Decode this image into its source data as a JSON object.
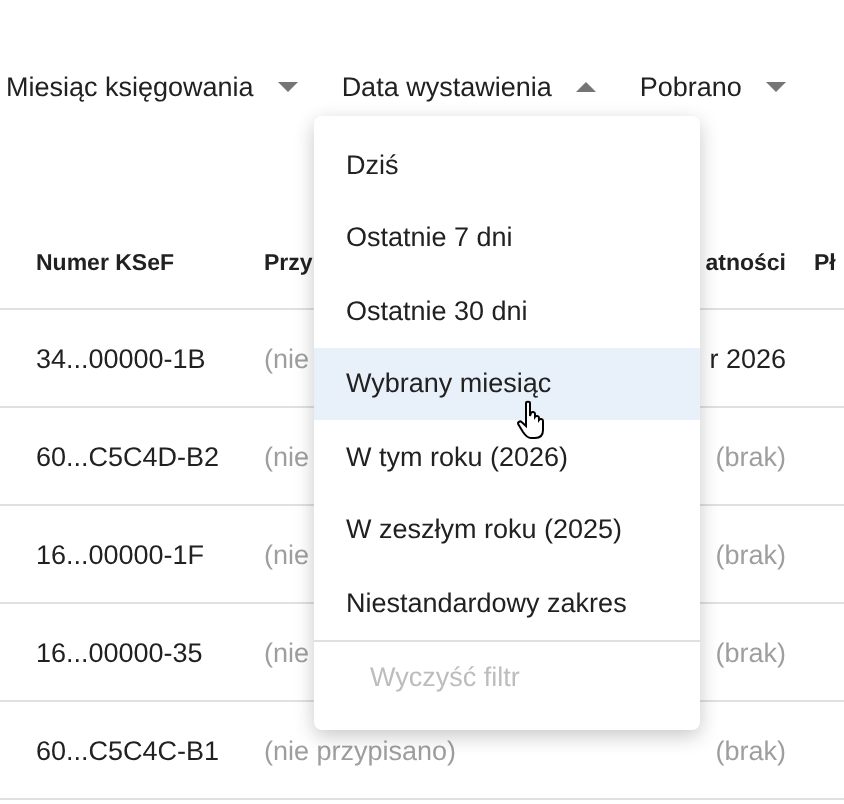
{
  "filters": [
    {
      "label": "Miesiąc księgowania",
      "expanded": false
    },
    {
      "label": "Data wystawienia",
      "expanded": true
    },
    {
      "label": "Pobrano",
      "expanded": false
    }
  ],
  "table": {
    "columns": [
      "Numer KSeF",
      "Przy",
      "atności",
      "Pł"
    ],
    "rows": [
      {
        "cells": [
          {
            "text": "34...00000-1B",
            "muted": false
          },
          {
            "text": "(nie",
            "muted": true
          },
          {
            "text": "r 2026",
            "muted": false
          }
        ]
      },
      {
        "cells": [
          {
            "text": "60...C5C4D-B2",
            "muted": false
          },
          {
            "text": "(nie",
            "muted": true
          },
          {
            "text": "(brak)",
            "muted": true
          }
        ]
      },
      {
        "cells": [
          {
            "text": "16...00000-1F",
            "muted": false
          },
          {
            "text": "(nie",
            "muted": true
          },
          {
            "text": "(brak)",
            "muted": true
          }
        ]
      },
      {
        "cells": [
          {
            "text": "16...00000-35",
            "muted": false
          },
          {
            "text": "(nie",
            "muted": true
          },
          {
            "text": "(brak)",
            "muted": true
          }
        ]
      },
      {
        "cells": [
          {
            "text": "60...C5C4C-B1",
            "muted": false
          },
          {
            "text": "(nie przypisano)",
            "muted": true
          },
          {
            "text": "(brak)",
            "muted": true
          }
        ]
      }
    ]
  },
  "dropdown": {
    "items": [
      {
        "label": "Dziś",
        "highlighted": false
      },
      {
        "label": "Ostatnie 7 dni",
        "highlighted": false
      },
      {
        "label": "Ostatnie 30 dni",
        "highlighted": false
      },
      {
        "label": "Wybrany miesiąc",
        "highlighted": true
      },
      {
        "label": "W tym roku (2026)",
        "highlighted": false
      },
      {
        "label": "W zeszłym roku (2025)",
        "highlighted": false
      },
      {
        "label": "Niestandardowy zakres",
        "highlighted": false
      }
    ],
    "clear_button": {
      "label": "Wyczyść filtr",
      "disabled": true
    }
  }
}
